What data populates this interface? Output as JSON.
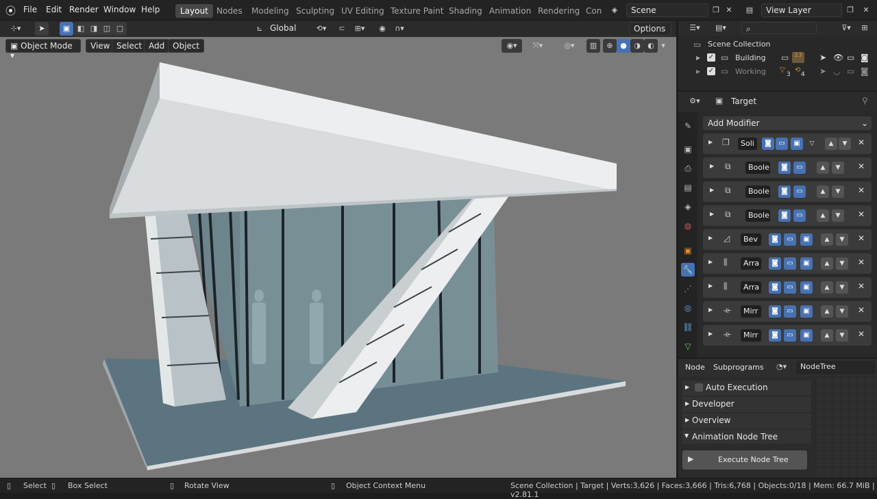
{
  "menu": {
    "file": "File",
    "edit": "Edit",
    "render": "Render",
    "window": "Window",
    "help": "Help"
  },
  "workspaces": [
    "Layout",
    "Nodes",
    "Modeling",
    "Sculpting",
    "UV Editing",
    "Texture Paint",
    "Shading",
    "Animation",
    "Rendering",
    "Con"
  ],
  "scene": "Scene",
  "view_layer": "View Layer",
  "header": {
    "transform_orientation": "Global",
    "options": "Options"
  },
  "viewport_header": {
    "mode": "Object Mode",
    "view": "View",
    "select": "Select",
    "add": "Add",
    "object": "Object"
  },
  "outliner": {
    "root": "Scene Collection",
    "rows": [
      {
        "name": "Building",
        "badge": "13"
      },
      {
        "name": "Working",
        "badge1": "3",
        "badge2": "4"
      }
    ]
  },
  "properties": {
    "object": "Target",
    "add_modifier": "Add Modifier",
    "modifiers": [
      {
        "name": "Soli",
        "icon": "solidify-icon"
      },
      {
        "name": "Boole",
        "icon": "boolean-icon"
      },
      {
        "name": "Boole",
        "icon": "boolean-icon"
      },
      {
        "name": "Boole",
        "icon": "boolean-icon"
      },
      {
        "name": "Bev",
        "icon": "bevel-icon"
      },
      {
        "name": "Arra",
        "icon": "array-icon"
      },
      {
        "name": "Arra",
        "icon": "array-icon"
      },
      {
        "name": "Mirr",
        "icon": "mirror-icon"
      },
      {
        "name": "Mirr",
        "icon": "mirror-icon"
      }
    ]
  },
  "node_panel": {
    "tabs": {
      "node": "Node",
      "subprograms": "Subprograms"
    },
    "tree": "NodeTree",
    "items": [
      "Auto Execution",
      "Developer",
      "Overview",
      "Animation Node Tree"
    ],
    "execute": "Execute Node Tree"
  },
  "status": {
    "select": "Select",
    "box_select": "Box Select",
    "rotate": "Rotate View",
    "context": "Object Context Menu",
    "stats": "Scene Collection | Target | Verts:3,626 | Faces:3,666 | Tris:6,768 | Objects:0/18 | Mem: 66.7 MiB | v2.81.1"
  },
  "colors": {
    "accent": "#4772b3",
    "active_tab": "#474747",
    "viewport_bg": "#7a7a7a",
    "orange": "#e08a2e"
  }
}
